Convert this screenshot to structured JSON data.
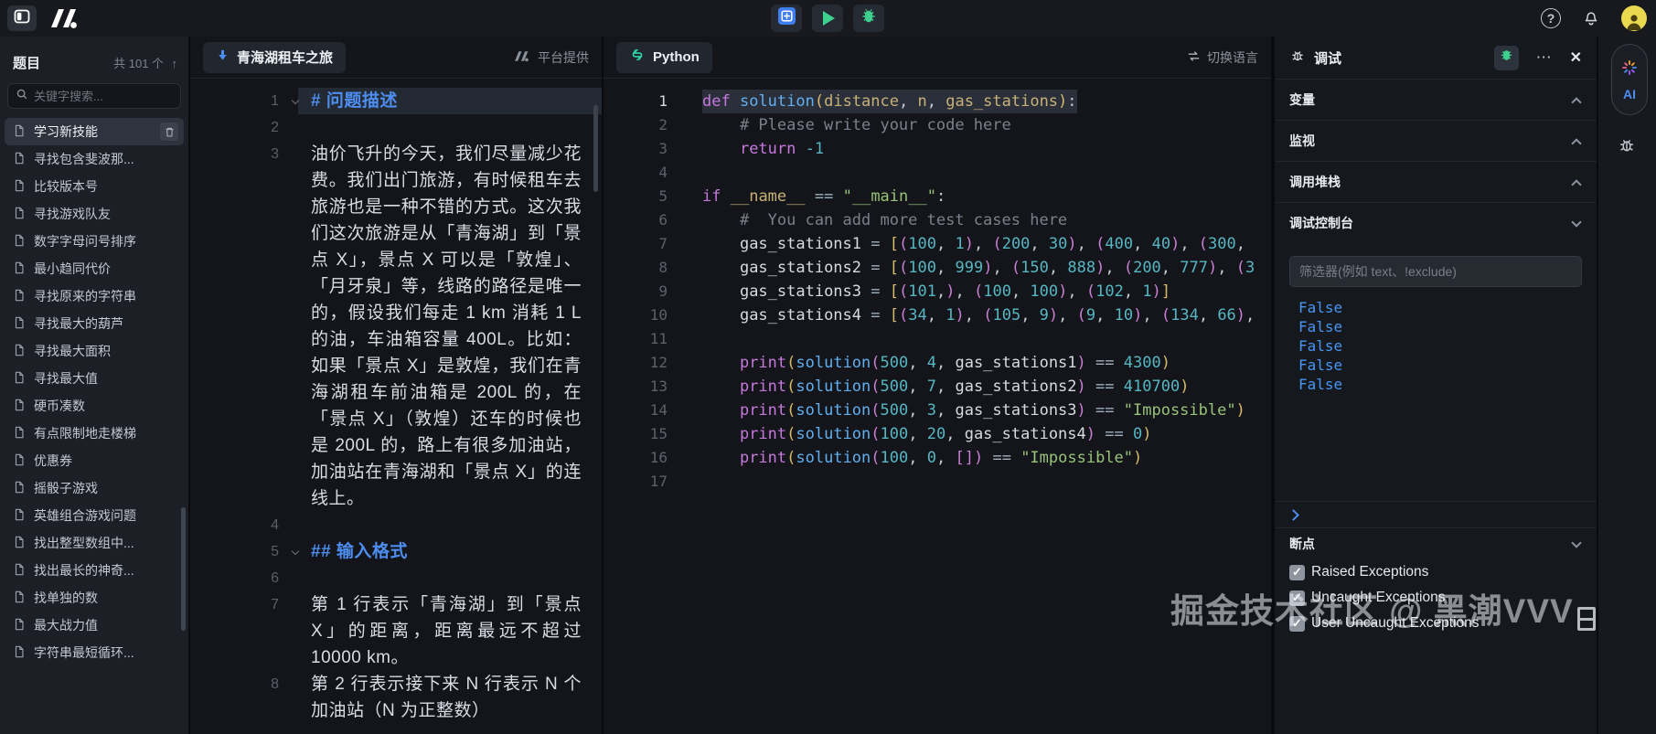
{
  "colors": {
    "accent_blue": "#4d8df0",
    "run_green": "#3ecf8e",
    "console_blue": "#4795f2",
    "avatar_yellow": "#e9d94f"
  },
  "syntax": {
    "kw": "#c678dd",
    "fn": "#61afef",
    "pm": "#c8b178",
    "vr": "#d6dae2",
    "nm": "#56b6c2",
    "st": "#98c379",
    "cm": "#7a818c",
    "op": "#9fb0bf",
    "b1": "#d7ba6a",
    "b2": "#c97fd4",
    "pl": "#c5cad3"
  },
  "topbar": {
    "help_label": "?"
  },
  "sidebar": {
    "title": "题目",
    "count": "共 101 个",
    "search_placeholder": "关键字搜索...",
    "items": [
      {
        "label": "学习新技能",
        "selected": true
      },
      {
        "label": "寻找包含斐波那...",
        "selected": false
      },
      {
        "label": "比较版本号",
        "selected": false
      },
      {
        "label": "寻找游戏队友",
        "selected": false
      },
      {
        "label": "数字字母问号排序",
        "selected": false
      },
      {
        "label": "最小趋同代价",
        "selected": false
      },
      {
        "label": "寻找原来的字符串",
        "selected": false
      },
      {
        "label": "寻找最大的葫芦",
        "selected": false
      },
      {
        "label": "寻找最大面积",
        "selected": false
      },
      {
        "label": "寻找最大值",
        "selected": false
      },
      {
        "label": "硬币凑数",
        "selected": false
      },
      {
        "label": "有点限制地走楼梯",
        "selected": false
      },
      {
        "label": "优惠券",
        "selected": false
      },
      {
        "label": "摇骰子游戏",
        "selected": false
      },
      {
        "label": "英雄组合游戏问题",
        "selected": false
      },
      {
        "label": "找出整型数组中...",
        "selected": false
      },
      {
        "label": "找出最长的神奇...",
        "selected": false
      },
      {
        "label": "找单独的数",
        "selected": false
      },
      {
        "label": "最大战力值",
        "selected": false
      },
      {
        "label": "字符串最短循环...",
        "selected": false
      }
    ]
  },
  "problem": {
    "tab_title": "青海湖租车之旅",
    "provider_label": "平台提供",
    "doc_lines": [
      {
        "num": 1,
        "kind": "h1",
        "text": "# 问题描述"
      },
      {
        "num": 2,
        "kind": "blank",
        "text": ""
      },
      {
        "num": 3,
        "kind": "p",
        "text": "油价飞升的今天，我们尽量减少花费。我们出门旅游，有时候租车去旅游也是一种不错的方式。这次我们这次旅游是从「青海湖」到「景点 X」，景点 X 可以是「敦煌」、「月牙泉」等，线路的路径是唯一的，假设我们每走 1 km 消耗 1 L 的油，车油箱容量 400L。比如：如果「景点 X」是敦煌，我们在青海湖租车前油箱是 200L 的，在「景点 X」（敦煌）还车的时候也是 200L 的，路上有很多加油站，加油站在青海湖和「景点 X」的连线上。"
      },
      {
        "num": 4,
        "kind": "blank",
        "text": ""
      },
      {
        "num": 5,
        "kind": "h2",
        "text": "## 输入格式"
      },
      {
        "num": 6,
        "kind": "blank",
        "text": ""
      },
      {
        "num": 7,
        "kind": "p",
        "text": "第 1 行表示「青海湖」到「景点 X」的距离，距离最远不超过 10000 km。"
      },
      {
        "num": 8,
        "kind": "p",
        "text": "第 2 行表示接下来 N 行表示 N 个加油站（N 为正整数）"
      }
    ]
  },
  "editor": {
    "tab_label": "Python",
    "switch_language_label": "切换语言",
    "lines": [
      {
        "n": 1,
        "current": true,
        "tokens": [
          [
            "kw",
            "def"
          ],
          [
            "pl",
            " "
          ],
          [
            "fn",
            "solution"
          ],
          [
            "b1",
            "("
          ],
          [
            "pm",
            "distance"
          ],
          [
            "pl",
            ", "
          ],
          [
            "pm",
            "n"
          ],
          [
            "pl",
            ", "
          ],
          [
            "pm",
            "gas_stations"
          ],
          [
            "b1",
            ")"
          ],
          [
            "pl",
            ":"
          ]
        ]
      },
      {
        "n": 2,
        "tokens": [
          [
            "cm",
            "    # Please write your code here"
          ]
        ]
      },
      {
        "n": 3,
        "tokens": [
          [
            "pl",
            "    "
          ],
          [
            "kw",
            "return"
          ],
          [
            "pl",
            " "
          ],
          [
            "nm",
            "-1"
          ]
        ]
      },
      {
        "n": 4,
        "tokens": []
      },
      {
        "n": 5,
        "tokens": [
          [
            "kw",
            "if"
          ],
          [
            "pl",
            " "
          ],
          [
            "pm",
            "__name__"
          ],
          [
            "pl",
            " "
          ],
          [
            "op",
            "=="
          ],
          [
            "pl",
            " "
          ],
          [
            "st",
            "\"__main__\""
          ],
          [
            "pl",
            ":"
          ]
        ]
      },
      {
        "n": 6,
        "tokens": [
          [
            "cm",
            "    #  You can add more test cases here"
          ]
        ]
      },
      {
        "n": 7,
        "tokens": [
          [
            "pl",
            "    "
          ],
          [
            "vr",
            "gas_stations1"
          ],
          [
            "pl",
            " "
          ],
          [
            "op",
            "="
          ],
          [
            "pl",
            " "
          ],
          [
            "b1",
            "["
          ],
          [
            "b2",
            "("
          ],
          [
            "nm",
            "100"
          ],
          [
            "pl",
            ", "
          ],
          [
            "nm",
            "1"
          ],
          [
            "b2",
            ")"
          ],
          [
            "pl",
            ", "
          ],
          [
            "b2",
            "("
          ],
          [
            "nm",
            "200"
          ],
          [
            "pl",
            ", "
          ],
          [
            "nm",
            "30"
          ],
          [
            "b2",
            ")"
          ],
          [
            "pl",
            ", "
          ],
          [
            "b2",
            "("
          ],
          [
            "nm",
            "400"
          ],
          [
            "pl",
            ", "
          ],
          [
            "nm",
            "40"
          ],
          [
            "b2",
            ")"
          ],
          [
            "pl",
            ", "
          ],
          [
            "b2",
            "("
          ],
          [
            "nm",
            "300"
          ],
          [
            "pl",
            ","
          ]
        ]
      },
      {
        "n": 8,
        "tokens": [
          [
            "pl",
            "    "
          ],
          [
            "vr",
            "gas_stations2"
          ],
          [
            "pl",
            " "
          ],
          [
            "op",
            "="
          ],
          [
            "pl",
            " "
          ],
          [
            "b1",
            "["
          ],
          [
            "b2",
            "("
          ],
          [
            "nm",
            "100"
          ],
          [
            "pl",
            ", "
          ],
          [
            "nm",
            "999"
          ],
          [
            "b2",
            ")"
          ],
          [
            "pl",
            ", "
          ],
          [
            "b2",
            "("
          ],
          [
            "nm",
            "150"
          ],
          [
            "pl",
            ", "
          ],
          [
            "nm",
            "888"
          ],
          [
            "b2",
            ")"
          ],
          [
            "pl",
            ", "
          ],
          [
            "b2",
            "("
          ],
          [
            "nm",
            "200"
          ],
          [
            "pl",
            ", "
          ],
          [
            "nm",
            "777"
          ],
          [
            "b2",
            ")"
          ],
          [
            "pl",
            ", "
          ],
          [
            "b2",
            "("
          ],
          [
            "nm",
            "3"
          ]
        ]
      },
      {
        "n": 9,
        "tokens": [
          [
            "pl",
            "    "
          ],
          [
            "vr",
            "gas_stations3"
          ],
          [
            "pl",
            " "
          ],
          [
            "op",
            "="
          ],
          [
            "pl",
            " "
          ],
          [
            "b1",
            "["
          ],
          [
            "b2",
            "("
          ],
          [
            "nm",
            "101"
          ],
          [
            "pl",
            ","
          ],
          [
            "b2",
            ")"
          ],
          [
            "pl",
            ", "
          ],
          [
            "b2",
            "("
          ],
          [
            "nm",
            "100"
          ],
          [
            "pl",
            ", "
          ],
          [
            "nm",
            "100"
          ],
          [
            "b2",
            ")"
          ],
          [
            "pl",
            ", "
          ],
          [
            "b2",
            "("
          ],
          [
            "nm",
            "102"
          ],
          [
            "pl",
            ", "
          ],
          [
            "nm",
            "1"
          ],
          [
            "b2",
            ")"
          ],
          [
            "b1",
            "]"
          ]
        ]
      },
      {
        "n": 10,
        "tokens": [
          [
            "pl",
            "    "
          ],
          [
            "vr",
            "gas_stations4"
          ],
          [
            "pl",
            " "
          ],
          [
            "op",
            "="
          ],
          [
            "pl",
            " "
          ],
          [
            "b1",
            "["
          ],
          [
            "b2",
            "("
          ],
          [
            "nm",
            "34"
          ],
          [
            "pl",
            ", "
          ],
          [
            "nm",
            "1"
          ],
          [
            "b2",
            ")"
          ],
          [
            "pl",
            ", "
          ],
          [
            "b2",
            "("
          ],
          [
            "nm",
            "105"
          ],
          [
            "pl",
            ", "
          ],
          [
            "nm",
            "9"
          ],
          [
            "b2",
            ")"
          ],
          [
            "pl",
            ", "
          ],
          [
            "b2",
            "("
          ],
          [
            "nm",
            "9"
          ],
          [
            "pl",
            ", "
          ],
          [
            "nm",
            "10"
          ],
          [
            "b2",
            ")"
          ],
          [
            "pl",
            ", "
          ],
          [
            "b2",
            "("
          ],
          [
            "nm",
            "134"
          ],
          [
            "pl",
            ", "
          ],
          [
            "nm",
            "66"
          ],
          [
            "b2",
            ")"
          ],
          [
            "pl",
            ","
          ]
        ]
      },
      {
        "n": 11,
        "tokens": []
      },
      {
        "n": 12,
        "tokens": [
          [
            "pl",
            "    "
          ],
          [
            "kw",
            "print"
          ],
          [
            "b1",
            "("
          ],
          [
            "fn",
            "solution"
          ],
          [
            "b2",
            "("
          ],
          [
            "nm",
            "500"
          ],
          [
            "pl",
            ", "
          ],
          [
            "nm",
            "4"
          ],
          [
            "pl",
            ", "
          ],
          [
            "vr",
            "gas_stations1"
          ],
          [
            "b2",
            ")"
          ],
          [
            "pl",
            " "
          ],
          [
            "op",
            "=="
          ],
          [
            "pl",
            " "
          ],
          [
            "nm",
            "4300"
          ],
          [
            "b1",
            ")"
          ]
        ]
      },
      {
        "n": 13,
        "tokens": [
          [
            "pl",
            "    "
          ],
          [
            "kw",
            "print"
          ],
          [
            "b1",
            "("
          ],
          [
            "fn",
            "solution"
          ],
          [
            "b2",
            "("
          ],
          [
            "nm",
            "500"
          ],
          [
            "pl",
            ", "
          ],
          [
            "nm",
            "7"
          ],
          [
            "pl",
            ", "
          ],
          [
            "vr",
            "gas_stations2"
          ],
          [
            "b2",
            ")"
          ],
          [
            "pl",
            " "
          ],
          [
            "op",
            "=="
          ],
          [
            "pl",
            " "
          ],
          [
            "nm",
            "410700"
          ],
          [
            "b1",
            ")"
          ]
        ]
      },
      {
        "n": 14,
        "tokens": [
          [
            "pl",
            "    "
          ],
          [
            "kw",
            "print"
          ],
          [
            "b1",
            "("
          ],
          [
            "fn",
            "solution"
          ],
          [
            "b2",
            "("
          ],
          [
            "nm",
            "500"
          ],
          [
            "pl",
            ", "
          ],
          [
            "nm",
            "3"
          ],
          [
            "pl",
            ", "
          ],
          [
            "vr",
            "gas_stations3"
          ],
          [
            "b2",
            ")"
          ],
          [
            "pl",
            " "
          ],
          [
            "op",
            "=="
          ],
          [
            "pl",
            " "
          ],
          [
            "st",
            "\"Impossible\""
          ],
          [
            "b1",
            ")"
          ]
        ]
      },
      {
        "n": 15,
        "tokens": [
          [
            "pl",
            "    "
          ],
          [
            "kw",
            "print"
          ],
          [
            "b1",
            "("
          ],
          [
            "fn",
            "solution"
          ],
          [
            "b2",
            "("
          ],
          [
            "nm",
            "100"
          ],
          [
            "pl",
            ", "
          ],
          [
            "nm",
            "20"
          ],
          [
            "pl",
            ", "
          ],
          [
            "vr",
            "gas_stations4"
          ],
          [
            "b2",
            ")"
          ],
          [
            "pl",
            " "
          ],
          [
            "op",
            "=="
          ],
          [
            "pl",
            " "
          ],
          [
            "nm",
            "0"
          ],
          [
            "b1",
            ")"
          ]
        ]
      },
      {
        "n": 16,
        "tokens": [
          [
            "pl",
            "    "
          ],
          [
            "kw",
            "print"
          ],
          [
            "b1",
            "("
          ],
          [
            "fn",
            "solution"
          ],
          [
            "b2",
            "("
          ],
          [
            "nm",
            "100"
          ],
          [
            "pl",
            ", "
          ],
          [
            "nm",
            "0"
          ],
          [
            "pl",
            ", "
          ],
          [
            "b2",
            "[]"
          ],
          [
            "b2",
            ")"
          ],
          [
            "pl",
            " "
          ],
          [
            "op",
            "=="
          ],
          [
            "pl",
            " "
          ],
          [
            "st",
            "\"Impossible\""
          ],
          [
            "b1",
            ")"
          ]
        ]
      },
      {
        "n": 17,
        "tokens": []
      }
    ]
  },
  "debug": {
    "title": "调试",
    "sections": [
      {
        "label": "变量",
        "state": "up"
      },
      {
        "label": "监视",
        "state": "up"
      },
      {
        "label": "调用堆栈",
        "state": "up"
      },
      {
        "label": "调试控制台",
        "state": "down"
      }
    ],
    "console": {
      "filter_placeholder": "筛选器(例如 text、!exclude)",
      "values": [
        "False",
        "False",
        "False",
        "False",
        "False"
      ]
    },
    "breakpoints": {
      "title": "断点",
      "items": [
        {
          "label": "Raised Exceptions",
          "checked": true
        },
        {
          "label": "Uncaught Exceptions",
          "checked": true
        },
        {
          "label": "User Uncaught Exceptions",
          "checked": true
        }
      ]
    }
  },
  "right_rail": {
    "ai_label": "AI"
  },
  "watermark": {
    "text": "掘金技术社区 @ 黑潮VVV"
  }
}
